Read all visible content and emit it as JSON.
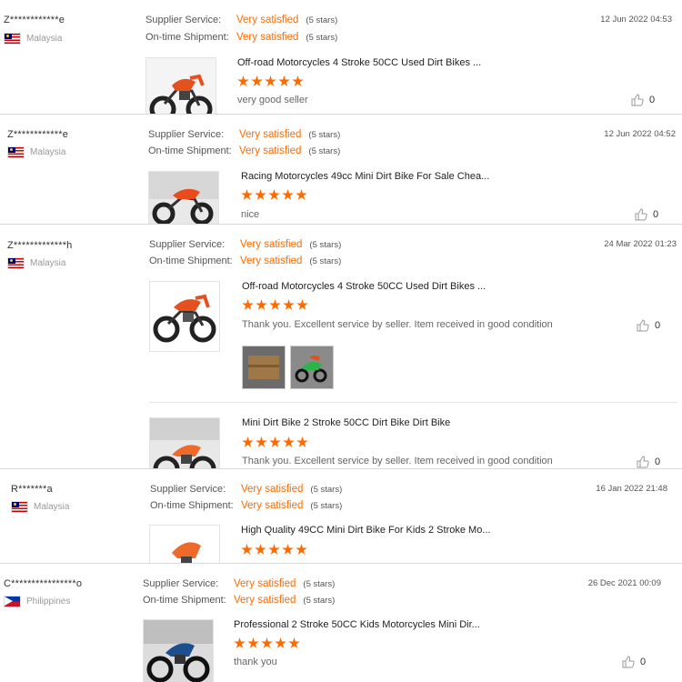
{
  "labels": {
    "supplier_service": "Supplier Service:",
    "ontime_shipment": "On-time Shipment:",
    "stars_note": "(5 stars)"
  },
  "colors": {
    "accent": "#ff6a00"
  },
  "icons": {
    "like": "thumbs-up-icon"
  },
  "reviews": [
    {
      "user": "Z************e",
      "country": "Malaysia",
      "flag": "malaysia-flag",
      "supplier_service": "Very satisfied",
      "ontime_shipment": "Very satisfied",
      "date": "12 Jun 2022 04:53",
      "products": [
        {
          "title": "Off-road Motorcycles 4 Stroke 50CC Used Dirt Bikes ...",
          "rating": 5,
          "comment": "very good seller",
          "likes": "0"
        }
      ]
    },
    {
      "user": "Z************e",
      "country": "Malaysia",
      "flag": "malaysia-flag",
      "supplier_service": "Very satisfied",
      "ontime_shipment": "Very satisfied",
      "date": "12 Jun 2022 04:52",
      "products": [
        {
          "title": "Racing Motorcycles 49cc Mini Dirt Bike For Sale Chea...",
          "rating": 5,
          "comment": "nice",
          "likes": "0"
        }
      ]
    },
    {
      "user": "Z*************h",
      "country": "Malaysia",
      "flag": "malaysia-flag",
      "supplier_service": "Very satisfied",
      "ontime_shipment": "Very satisfied",
      "date": "24 Mar 2022 01:23",
      "products": [
        {
          "title": "Off-road Motorcycles 4 Stroke 50CC Used Dirt Bikes ...",
          "rating": 5,
          "comment": "Thank you. Excellent service by seller. Item received in good condition",
          "likes": "0"
        },
        {
          "title": "Mini Dirt Bike 2 Stroke 50CC Dirt Bike Dirt Bike",
          "rating": 5,
          "comment": "Thank you. Excellent service by seller. Item received in good condition",
          "likes": "0"
        }
      ]
    },
    {
      "user": "R*******a",
      "country": "Malaysia",
      "flag": "malaysia-flag",
      "supplier_service": "Very satisfied",
      "ontime_shipment": "Very satisfied",
      "date": "16 Jan 2022 21:48",
      "products": [
        {
          "title": "High Quality 49CC Mini Dirt Bike For Kids 2 Stroke Mo...",
          "rating": 5
        }
      ]
    },
    {
      "user": "C****************o",
      "country": "Philippines",
      "flag": "philippines-flag",
      "supplier_service": "Very satisfied",
      "ontime_shipment": "Very satisfied",
      "date": "26 Dec 2021 00:09",
      "products": [
        {
          "title": "Professional 2 Stroke 50CC Kids Motorcycles Mini Dir...",
          "rating": 5,
          "comment": "thank you",
          "likes": "0"
        }
      ]
    }
  ]
}
